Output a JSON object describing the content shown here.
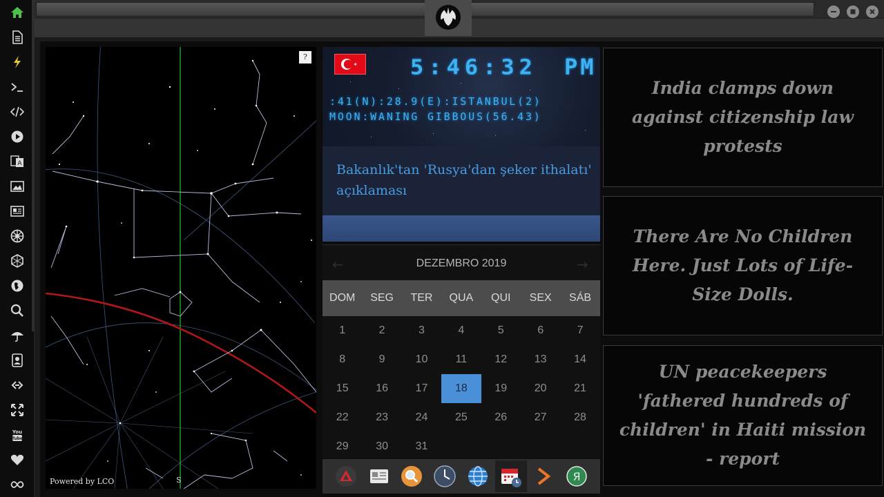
{
  "sidebar": {
    "items": [
      {
        "name": "home-icon",
        "color": "#4cc24c"
      },
      {
        "name": "document-icon"
      },
      {
        "name": "lightning-icon",
        "color": "#e8c833"
      },
      {
        "name": "terminal-icon"
      },
      {
        "name": "code-icon"
      },
      {
        "name": "play-icon"
      },
      {
        "name": "translate-icon"
      },
      {
        "name": "image-icon"
      },
      {
        "name": "newspaper-icon"
      },
      {
        "name": "galactic-empire-icon"
      },
      {
        "name": "hexagon-icon"
      },
      {
        "name": "globe-icon"
      },
      {
        "name": "search-icon"
      },
      {
        "name": "umbrella-icon"
      },
      {
        "name": "contacts-icon"
      },
      {
        "name": "link-icon"
      },
      {
        "name": "fullscreen-icon"
      },
      {
        "name": "youtube-icon",
        "label": "You Tube"
      },
      {
        "name": "heart-icon"
      },
      {
        "name": "infinity-icon"
      }
    ]
  },
  "window": {
    "logo": "rebel-alliance-icon",
    "controls": [
      "minimize-icon",
      "maximize-icon",
      "close-icon"
    ]
  },
  "starmap": {
    "help_label": "?",
    "credit": "Powered by LCO",
    "compass_label": "S"
  },
  "clock": {
    "flag": "turkey-flag-icon",
    "time": "5:46:32",
    "ampm": "PM",
    "location": ":41(N):28.9(E):ISTANBUL(2)",
    "moon": "MOON:WANING GIBBOUS(56.43)",
    "headline": "Bakanlık'tan 'Rusya'dan şeker ithalatı' açıklaması",
    "accent": "#3fb2f0"
  },
  "calendar": {
    "month_label": "DEZEMBRO 2019",
    "prev_icon": "arrow-left-icon",
    "next_icon": "arrow-right-icon",
    "weekdays": [
      "DOM",
      "SEG",
      "TER",
      "QUA",
      "QUI",
      "SEX",
      "SÁB"
    ],
    "weeks": [
      [
        "1",
        "2",
        "3",
        "4",
        "5",
        "6",
        "7"
      ],
      [
        "8",
        "9",
        "10",
        "11",
        "12",
        "13",
        "14"
      ],
      [
        "15",
        "16",
        "17",
        "18",
        "19",
        "20",
        "21"
      ],
      [
        "22",
        "23",
        "24",
        "25",
        "26",
        "27",
        "28"
      ],
      [
        "29",
        "30",
        "31",
        "",
        "",
        "",
        ""
      ]
    ],
    "today": "18",
    "today_color": "#4a90d8"
  },
  "dock": {
    "items": [
      {
        "name": "dock-app-red-triangle-icon"
      },
      {
        "name": "dock-app-news-icon"
      },
      {
        "name": "dock-app-search-icon"
      },
      {
        "name": "dock-app-clock-icon"
      },
      {
        "name": "dock-app-globe-icon"
      },
      {
        "name": "dock-app-calendar-icon",
        "active": true
      },
      {
        "name": "dock-app-arrow-icon"
      },
      {
        "name": "dock-app-yandex-icon",
        "label": "Я"
      }
    ]
  },
  "news": [
    {
      "headline": "India clamps down against citizenship law protests"
    },
    {
      "headline": "There Are No Children Here. Just Lots of Life-Size Dolls."
    },
    {
      "headline": "UN peacekeepers 'fathered hundreds of children' in Haiti mission - report"
    }
  ]
}
